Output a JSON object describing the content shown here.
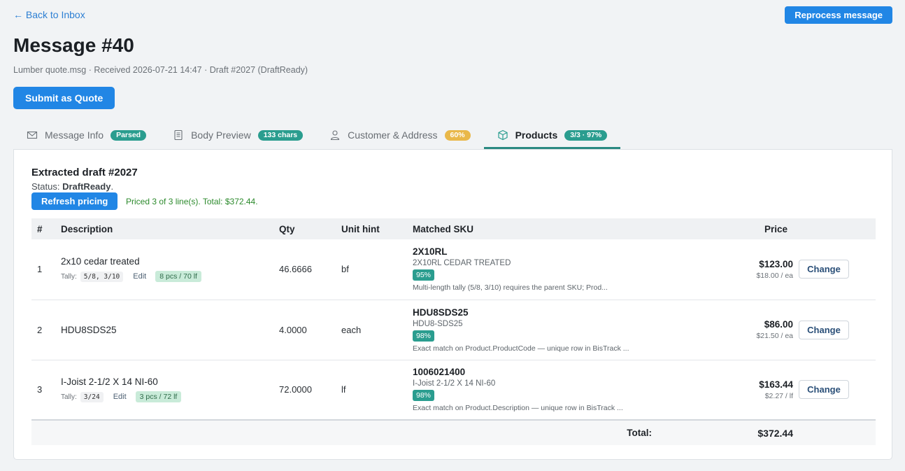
{
  "header": {
    "back_label": "← Back to Inbox",
    "reprocess_label": "Reprocess message",
    "title": "Message #40",
    "meta": "Lumber quote.msg · Received 2026-07-21 14:47 · Draft #2027 (DraftReady)",
    "submit_label": "Submit as Quote"
  },
  "tabs": [
    {
      "label": "Message Info",
      "badge": "Parsed",
      "icon": "envelope-icon"
    },
    {
      "label": "Body Preview",
      "badge": "133 chars",
      "icon": "document-icon"
    },
    {
      "label": "Customer & Address",
      "badge": "60%",
      "icon": "person-icon"
    },
    {
      "label": "Products",
      "badge": "3/3 · 97%",
      "icon": "box-icon"
    }
  ],
  "panel": {
    "title": "Extracted draft #2027",
    "status_prefix": "Status:",
    "status_value": "DraftReady",
    "refresh_label": "Refresh pricing",
    "priced_message": "Priced 3 of 3 line(s). Total: $372.44."
  },
  "table": {
    "headers": {
      "num": "#",
      "description": "Description",
      "qty": "Qty",
      "unit": "Unit hint",
      "sku": "Matched SKU",
      "price": "Price"
    },
    "rows": [
      {
        "num": "1",
        "description": "2x10 cedar treated",
        "tally_label": "Tally:",
        "tally_code": "5/8, 3/10",
        "tally_edit": "Edit",
        "tally_badge": "8 pcs / 70 lf",
        "qty": "46.6666",
        "unit": "bf",
        "sku_code": "2X10RL",
        "sku_name": "2X10RL CEDAR TREATED",
        "confidence": "95%",
        "note": "Multi-length tally (5/8, 3/10) requires the parent SKU; Prod...",
        "price": "$123.00",
        "unit_price": "$18.00 / ea",
        "action": "Change"
      },
      {
        "num": "2",
        "description": "HDU8SDS25",
        "qty": "4.0000",
        "unit": "each",
        "sku_code": "HDU8SDS25",
        "sku_name": "HDU8-SDS25",
        "confidence": "98%",
        "note": "Exact match on Product.ProductCode — unique row in BisTrack ...",
        "price": "$86.00",
        "unit_price": "$21.50 / ea",
        "action": "Change"
      },
      {
        "num": "3",
        "description": "I-Joist 2-1/2 X 14 NI-60",
        "tally_label": "Tally:",
        "tally_code": "3/24",
        "tally_edit": "Edit",
        "tally_badge": "3 pcs / 72 lf",
        "qty": "72.0000",
        "unit": "lf",
        "sku_code": "1006021400",
        "sku_name": "I-Joist 2-1/2 X 14 NI-60",
        "confidence": "98%",
        "note": "Exact match on Product.Description — unique row in BisTrack ...",
        "price": "$163.44",
        "unit_price": "$2.27 / lf",
        "action": "Change"
      }
    ],
    "total_label": "Total:",
    "total_value": "$372.44"
  },
  "colors": {
    "accent": "#2186e5",
    "teal": "#2a9d8f",
    "amber": "#e9b84a",
    "success": "#2c8a2c"
  }
}
